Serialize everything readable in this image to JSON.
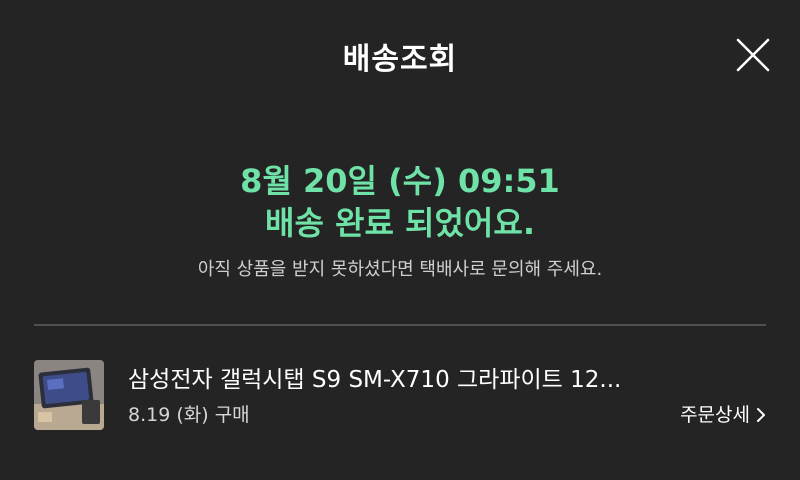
{
  "header": {
    "title": "배송조회",
    "close_icon": "close-icon"
  },
  "status": {
    "date_line": "8월 20일 (수) 09:51",
    "message": "배송 완료 되었어요.",
    "sub_message": "아직 상품을 받지 못하셨다면 택배사로 문의해 주세요.",
    "accent_color": "#6fe3a7"
  },
  "order": {
    "product_name": "삼성전자 갤럭시탭 S9 SM-X710 그라파이트 12...",
    "purchase_date": "8.19 (화) 구매",
    "detail_label": "주문상세",
    "detail_icon": "chevron-right-icon",
    "thumbnail_icon": "product-thumbnail"
  },
  "colors": {
    "background": "#242424",
    "divider": "#505050"
  }
}
